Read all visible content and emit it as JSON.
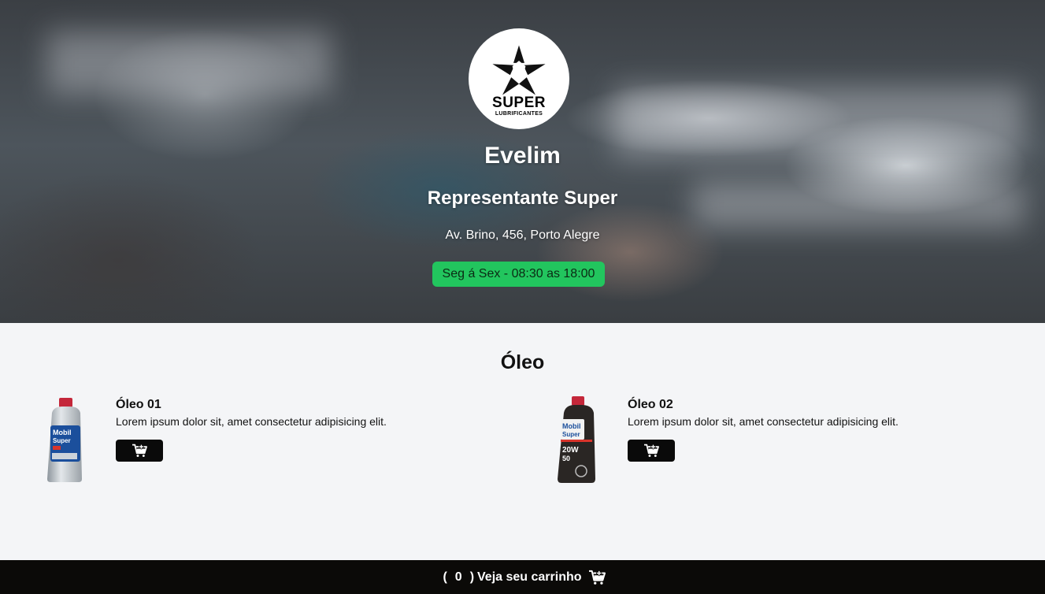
{
  "store": {
    "logo_word": "SUPER",
    "logo_sub": "LUBRIFICANTES",
    "name": "Evelim",
    "role": "Representante Super",
    "address": "Av. Brino, 456, Porto Alegre",
    "hours": "Seg á Sex - 08:30 as 18:00"
  },
  "section": {
    "title": "Óleo"
  },
  "products": [
    {
      "name": "Óleo 01",
      "description": "Lorem ipsum dolor sit, amet consectetur adipisicing elit.",
      "image_label": "Mobil Super"
    },
    {
      "name": "Óleo 02",
      "description": "Lorem ipsum dolor sit, amet consectetur adipisicing elit.",
      "image_label": "Mobil Super 20W 50"
    }
  ],
  "cart": {
    "open_paren": "(",
    "count": "0",
    "close_paren": ")",
    "label": "Veja seu carrinho",
    "icon": "cart-plus-icon"
  },
  "colors": {
    "hours_badge": "#22c55e",
    "footer": "#0b0a08",
    "page_bg": "#f4f5f7"
  }
}
